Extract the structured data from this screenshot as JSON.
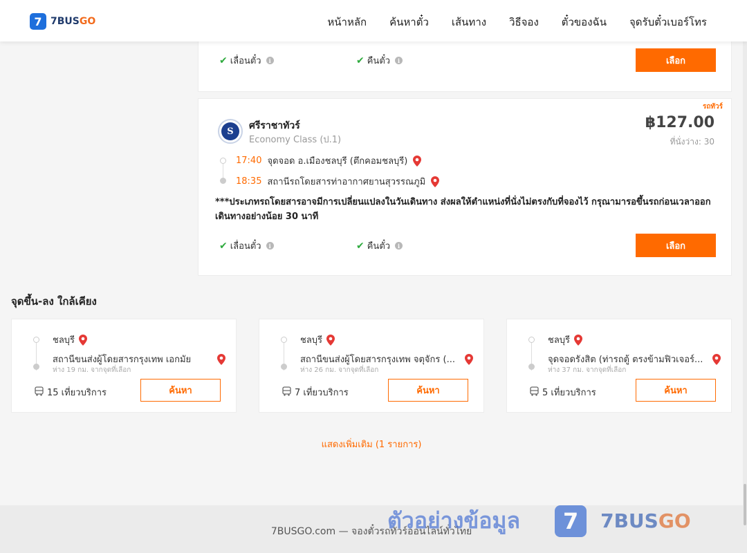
{
  "header": {
    "logo_mark": "7",
    "logo_brand": "7BUS",
    "logo_brand_go": "GO",
    "nav": [
      "หน้าหลัก",
      "ค้นหาตั๋ว",
      "เส้นทาง",
      "วิธีจอง",
      "ตั๋วของฉัน",
      "จุดรับตั๋วเบอร์โทร"
    ]
  },
  "prev_card": {
    "feature_change": "เลื่อนตั๋ว",
    "feature_refund": "คืนตั๋ว",
    "select_label": "เลือก"
  },
  "trip": {
    "operator_name": "ศรีราชาทัวร์",
    "operator_class": "Economy Class (ป.1)",
    "badge": "รถทัวร์",
    "price": "฿127.00",
    "seats": "ที่นั่งว่าง: 30",
    "stops": [
      {
        "time": "17:40",
        "name": "จุดจอด อ.เมืองชลบุรี (ตึกคอมชลบุรี)"
      },
      {
        "time": "18:35",
        "name": "สถานีรถโดยสารท่าอากาศยานสุวรรณภูมิ"
      }
    ],
    "notice": "***ประเภทรถโดยสารอาจมีการเปลี่ยนแปลงในวันเดินทาง ส่งผลให้ตำแหน่งที่นั่งไม่ตรงกับที่จองไว้ กรุณามารอขึ้นรถก่อนเวลาออกเดินทางอย่างน้อย 30 นาที",
    "feature_change": "เลื่อนตั๋ว",
    "feature_refund": "คืนตั๋ว",
    "select_label": "เลือก"
  },
  "nearby": {
    "title": "จุดขึ้น-ลง ใกล้เคียง",
    "items": [
      {
        "origin": "ชลบุรี",
        "dest": "สถานีขนส่งผู้โดยสารกรุงเทพ เอกมัย",
        "distance": "ห่าง 19 กม. จากจุดที่เลือก",
        "trips": "15 เที่ยวบริการ",
        "button": "ค้นหา"
      },
      {
        "origin": "ชลบุรี",
        "dest": "สถานีขนส่งผู้โดยสารกรุงเทพ จตุจักร (...",
        "distance": "ห่าง 26 กม. จากจุดที่เลือก",
        "trips": "7 เที่ยวบริการ",
        "button": "ค้นหา"
      },
      {
        "origin": "ชลบุรี",
        "dest": "จุดจอดรังสิต (ท่ารถตู้ ตรงข้ามฟิวเจอร์...",
        "distance": "ห่าง 37 กม. จากจุดที่เลือก",
        "trips": "5 เที่ยวบริการ",
        "button": "ค้นหา"
      }
    ],
    "show_more": "แสดงเพิ่มเติม (1 รายการ)"
  },
  "footer": {
    "text": "7BUSGO.com — จองตั๋วรถทัวร์ออนไลน์ทั่วไทย"
  },
  "watermark": {
    "text": "ตัวอย่างข้อมูล",
    "mark": "7",
    "brand": "7BUS",
    "brand_go": "GO"
  },
  "colors": {
    "accent": "#ff6a00",
    "check": "#2eaa3e",
    "pin": "#e53935",
    "brand_blue": "#1e6fdc"
  }
}
